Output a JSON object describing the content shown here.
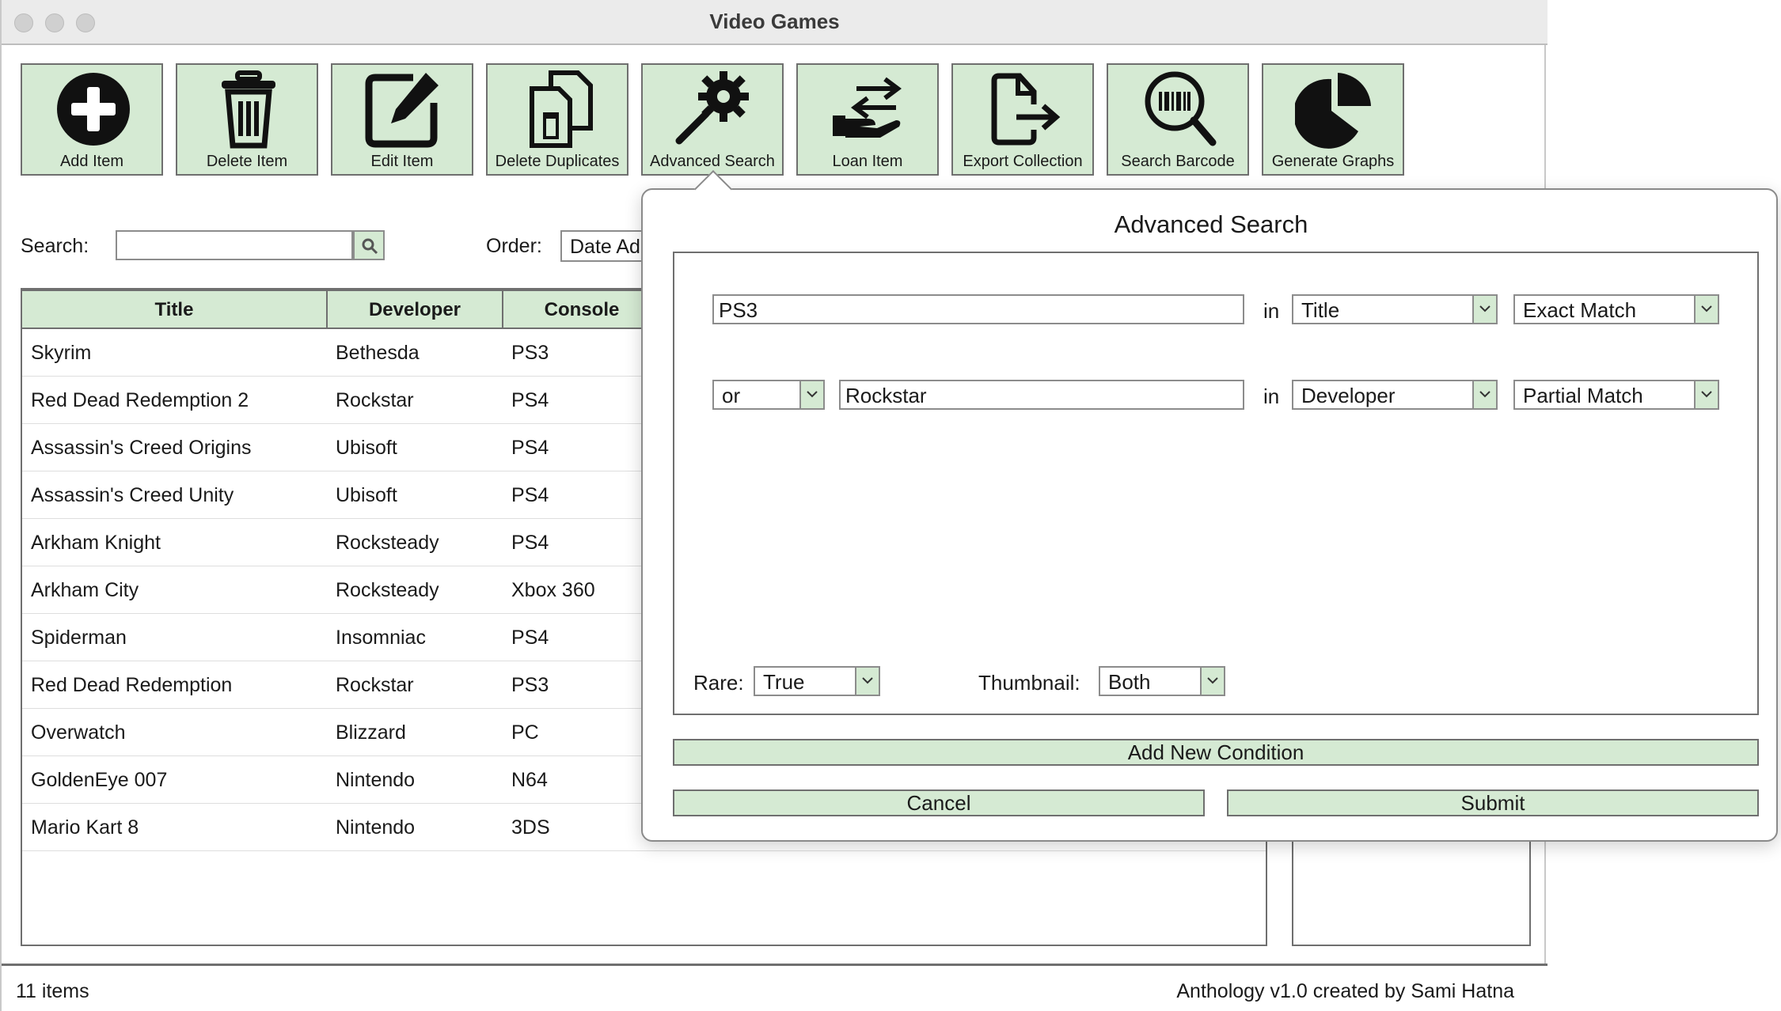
{
  "window": {
    "title": "Video Games"
  },
  "toolbar": {
    "buttons": [
      {
        "label": "Add Item",
        "icon": "plus-circle-icon"
      },
      {
        "label": "Delete Item",
        "icon": "trash-icon"
      },
      {
        "label": "Edit Item",
        "icon": "edit-icon"
      },
      {
        "label": "Delete Duplicates",
        "icon": "duplicate-trash-icon"
      },
      {
        "label": "Advanced Search",
        "icon": "magic-gear-icon"
      },
      {
        "label": "Loan Item",
        "icon": "hand-arrow-icon"
      },
      {
        "label": "Export Collection",
        "icon": "file-export-icon"
      },
      {
        "label": "Search Barcode",
        "icon": "barcode-search-icon"
      },
      {
        "label": "Generate Graphs",
        "icon": "pie-chart-icon"
      }
    ]
  },
  "search": {
    "label": "Search:",
    "value": ""
  },
  "order": {
    "label": "Order:",
    "value": "Date Added"
  },
  "table": {
    "columns": [
      "Title",
      "Developer",
      "Console"
    ],
    "rows": [
      [
        "Skyrim",
        "Bethesda",
        "PS3"
      ],
      [
        "Red Dead Redemption 2",
        "Rockstar",
        "PS4"
      ],
      [
        "Assassin's Creed Origins",
        "Ubisoft",
        "PS4"
      ],
      [
        "Assassin's Creed Unity",
        "Ubisoft",
        "PS4"
      ],
      [
        "Arkham Knight",
        "Rocksteady",
        "PS4"
      ],
      [
        "Arkham City",
        "Rocksteady",
        "Xbox 360"
      ],
      [
        "Spiderman",
        "Insomniac",
        "PS4"
      ],
      [
        "Red Dead Redemption",
        "Rockstar",
        "PS3"
      ],
      [
        "Overwatch",
        "Blizzard",
        "PC"
      ],
      [
        "GoldenEye 007",
        "Nintendo",
        "N64"
      ],
      [
        "Mario Kart 8",
        "Nintendo",
        "3DS"
      ]
    ]
  },
  "status": {
    "count": "11 items",
    "credit": "Anthology v1.0 created by Sami Hatna"
  },
  "advanced_search": {
    "title": "Advanced Search",
    "conditions": [
      {
        "connector": "",
        "term": "PS3",
        "in_label": "in",
        "field": "Title",
        "match": "Exact Match"
      },
      {
        "connector": "or",
        "term": "Rockstar",
        "in_label": "in",
        "field": "Developer",
        "match": "Partial Match"
      }
    ],
    "rare": {
      "label": "Rare:",
      "value": "True"
    },
    "thumbnail": {
      "label": "Thumbnail:",
      "value": "Both"
    },
    "add_condition_label": "Add New Condition",
    "cancel_label": "Cancel",
    "submit_label": "Submit"
  },
  "colors": {
    "button_bg": "#d5ead3",
    "border": "#6f6f6f"
  }
}
